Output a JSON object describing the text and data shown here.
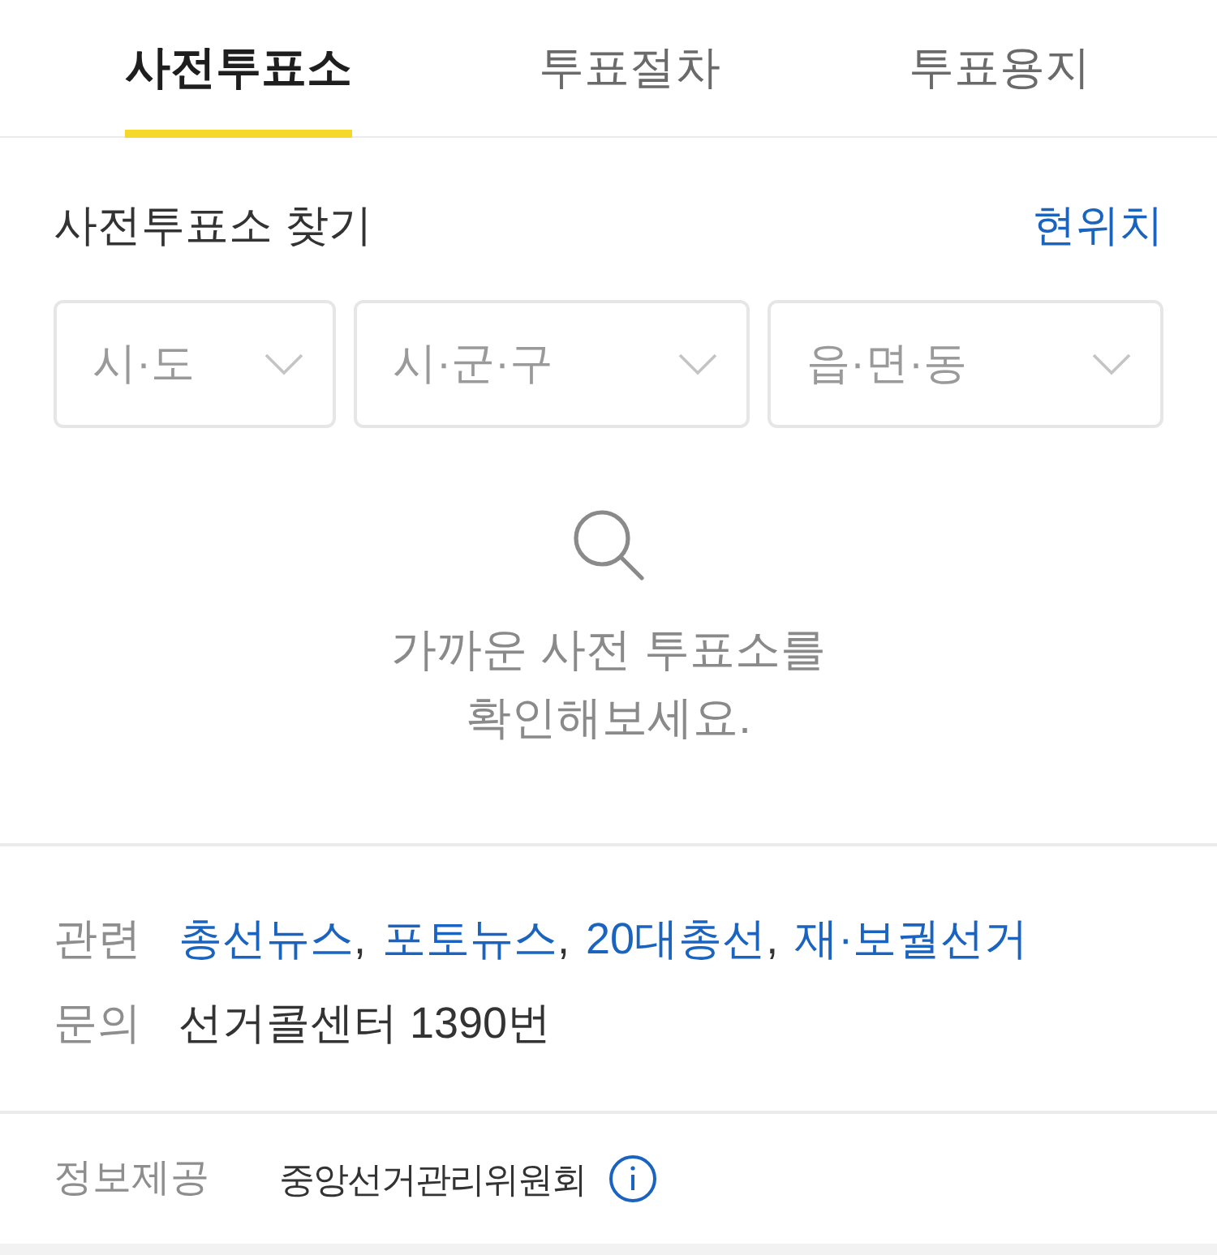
{
  "tabs": [
    {
      "label": "사전투표소",
      "selected": true
    },
    {
      "label": "투표절차",
      "selected": false
    },
    {
      "label": "투표용지",
      "selected": false
    }
  ],
  "finder": {
    "title": "사전투표소 찾기",
    "location_link": "현위치",
    "selects": [
      {
        "placeholder": "시·도"
      },
      {
        "placeholder": "시·군·구"
      },
      {
        "placeholder": "읍·면·동"
      }
    ]
  },
  "empty_state": {
    "message": "가까운 사전 투표소를\n확인해보세요."
  },
  "info": {
    "related": {
      "label": "관련",
      "links": [
        "총선뉴스",
        "포토뉴스",
        "20대총선",
        "재·보궐선거"
      ],
      "separator": ","
    },
    "inquiry": {
      "label": "문의",
      "value": "선거콜센터 1390번"
    }
  },
  "footer": {
    "label": "정보제공",
    "value": "중앙선거관리위원회"
  }
}
